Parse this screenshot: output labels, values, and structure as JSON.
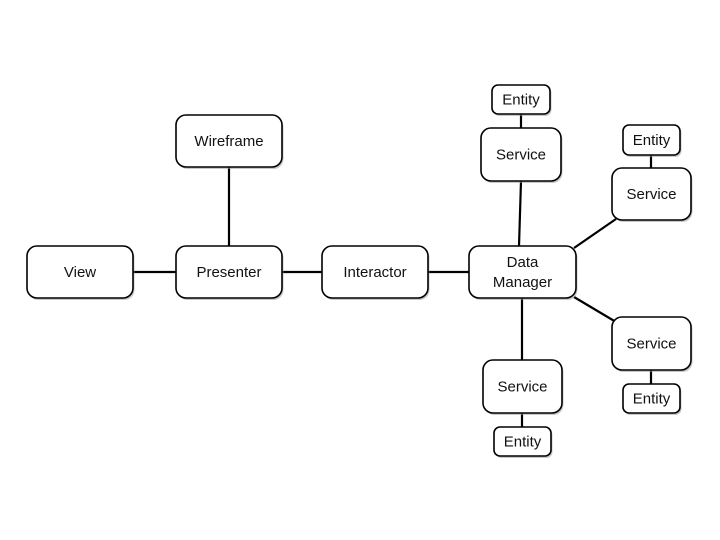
{
  "diagram": {
    "title": "",
    "nodes": [
      {
        "id": "view",
        "label": [
          "View"
        ],
        "kind": "component"
      },
      {
        "id": "presenter",
        "label": [
          "Presenter"
        ],
        "kind": "component"
      },
      {
        "id": "wireframe",
        "label": [
          "Wireframe"
        ],
        "kind": "component"
      },
      {
        "id": "interactor",
        "label": [
          "Interactor"
        ],
        "kind": "component"
      },
      {
        "id": "data-manager",
        "label": [
          "Data",
          "Manager"
        ],
        "kind": "component"
      },
      {
        "id": "service-top",
        "label": [
          "Service"
        ],
        "kind": "service"
      },
      {
        "id": "entity-top",
        "label": [
          "Entity"
        ],
        "kind": "entity"
      },
      {
        "id": "service-right-top",
        "label": [
          "Service"
        ],
        "kind": "service"
      },
      {
        "id": "entity-right-top",
        "label": [
          "Entity"
        ],
        "kind": "entity"
      },
      {
        "id": "service-right-bottom",
        "label": [
          "Service"
        ],
        "kind": "service"
      },
      {
        "id": "entity-right-bottom",
        "label": [
          "Entity"
        ],
        "kind": "entity"
      },
      {
        "id": "service-bottom",
        "label": [
          "Service"
        ],
        "kind": "service"
      },
      {
        "id": "entity-bottom",
        "label": [
          "Entity"
        ],
        "kind": "entity"
      }
    ],
    "edges": [
      {
        "from": "view",
        "to": "presenter"
      },
      {
        "from": "presenter",
        "to": "wireframe"
      },
      {
        "from": "presenter",
        "to": "interactor"
      },
      {
        "from": "interactor",
        "to": "data-manager"
      },
      {
        "from": "data-manager",
        "to": "service-top"
      },
      {
        "from": "service-top",
        "to": "entity-top"
      },
      {
        "from": "data-manager",
        "to": "service-right-top"
      },
      {
        "from": "service-right-top",
        "to": "entity-right-top"
      },
      {
        "from": "data-manager",
        "to": "service-right-bottom"
      },
      {
        "from": "service-right-bottom",
        "to": "entity-right-bottom"
      },
      {
        "from": "data-manager",
        "to": "service-bottom"
      },
      {
        "from": "service-bottom",
        "to": "entity-bottom"
      }
    ]
  }
}
